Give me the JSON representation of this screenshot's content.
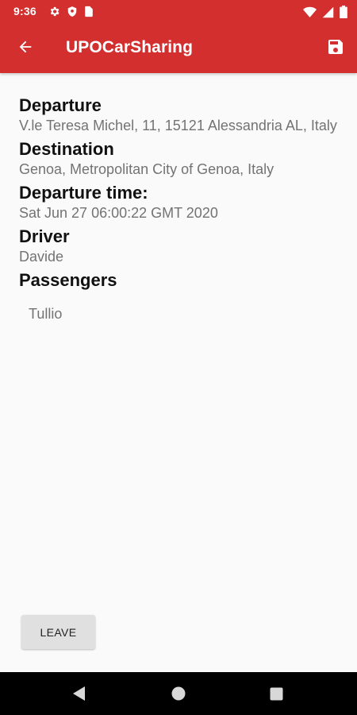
{
  "status_bar": {
    "time": "9:36",
    "left_icons": [
      "settings-icon",
      "shield-icon",
      "sim-card-icon"
    ],
    "right_icons": [
      "wifi-icon",
      "cell-signal-icon",
      "battery-icon"
    ]
  },
  "app_bar": {
    "title": "UPOCarSharing",
    "back_icon": "arrow-back-icon",
    "save_icon": "save-icon",
    "color": "#d32f2f"
  },
  "ride": {
    "departure_label": "Departure",
    "departure_value": "V.le Teresa Michel, 11, 15121 Alessandria AL, Italy",
    "destination_label": "Destination",
    "destination_value": "Genoa, Metropolitan City of Genoa, Italy",
    "departure_time_label": "Departure time:",
    "departure_time_value": "Sat Jun 27 06:00:22 GMT 2020",
    "driver_label": "Driver",
    "driver_value": "Davide",
    "passengers_label": "Passengers",
    "passengers": [
      "Tullio"
    ]
  },
  "actions": {
    "leave_label": "LEAVE"
  },
  "nav_bar": {
    "icons": [
      "nav-back-icon",
      "nav-home-icon",
      "nav-recents-icon"
    ]
  }
}
